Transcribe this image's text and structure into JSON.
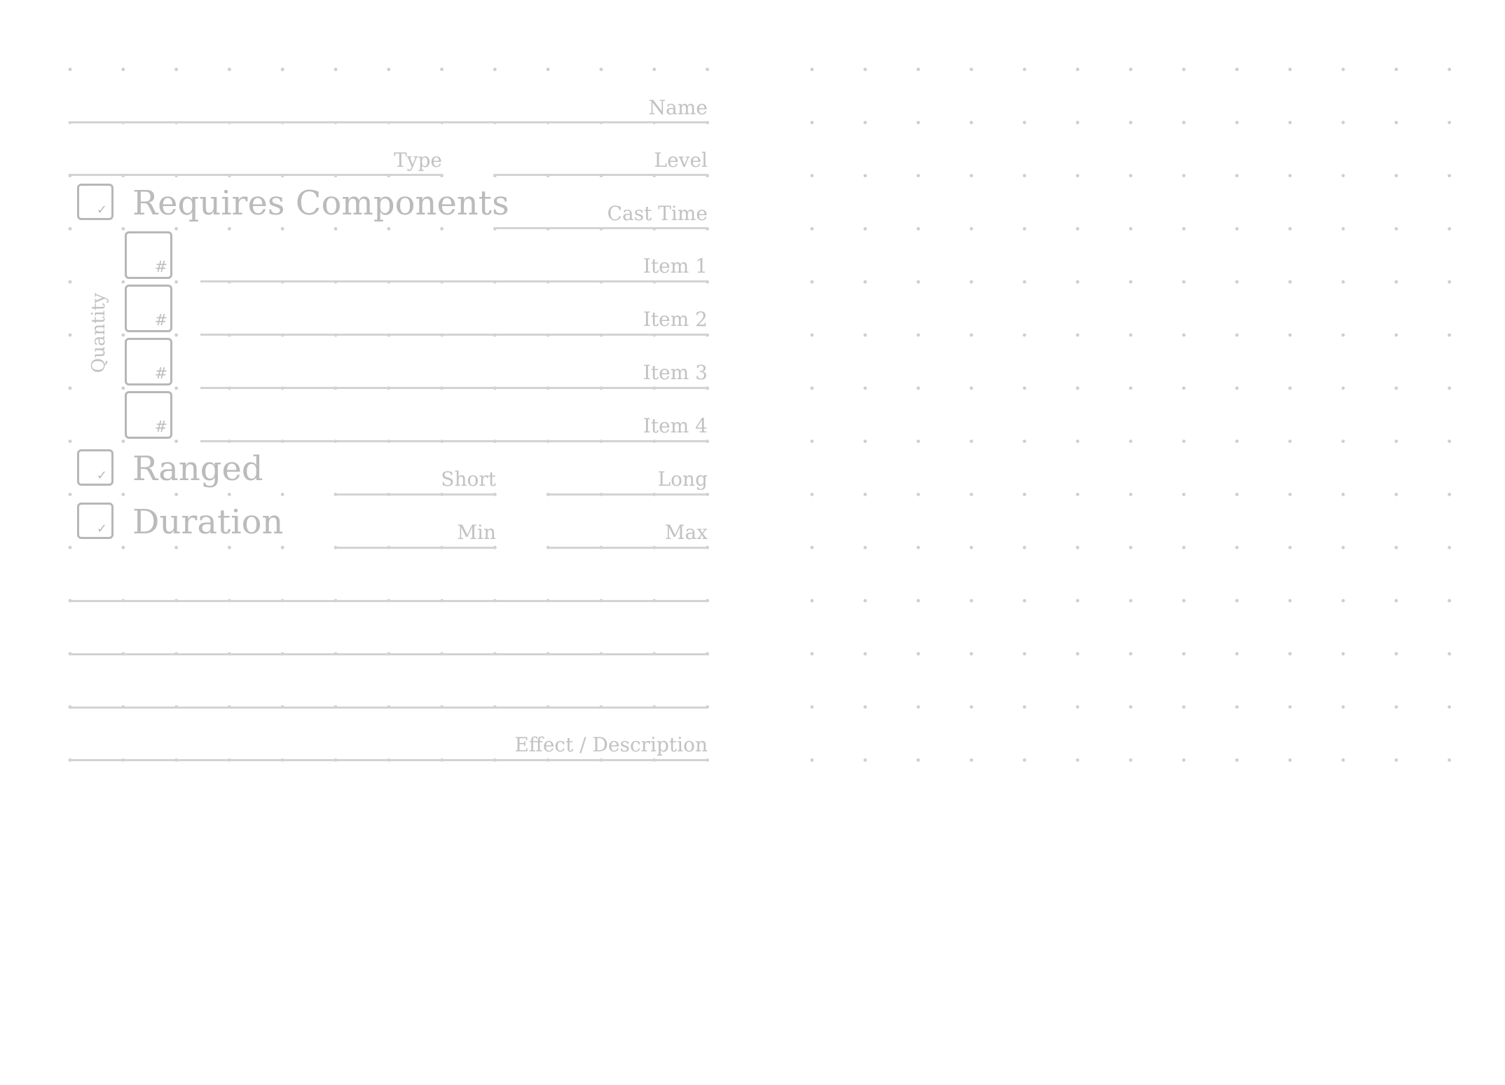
{
  "form": {
    "name_label": "Name",
    "type_label": "Type",
    "level_label": "Level",
    "cast_time_label": "Cast Time",
    "requires_components_label": "Requires Components",
    "quantity_label": "Quantity",
    "quantity_box_symbol": "#",
    "check_symbol": "✓",
    "items": [
      {
        "label": "Item 1"
      },
      {
        "label": "Item 2"
      },
      {
        "label": "Item 3"
      },
      {
        "label": "Item 4"
      }
    ],
    "ranged_label": "Ranged",
    "short_label": "Short",
    "long_label": "Long",
    "duration_label": "Duration",
    "min_label": "Min",
    "max_label": "Max",
    "effect_label": "Effect / Description"
  },
  "colors": {
    "ink": "#bdbdbd",
    "line": "#d3d3d3",
    "dot": "#cfcfcf",
    "background": "#ffffff"
  }
}
